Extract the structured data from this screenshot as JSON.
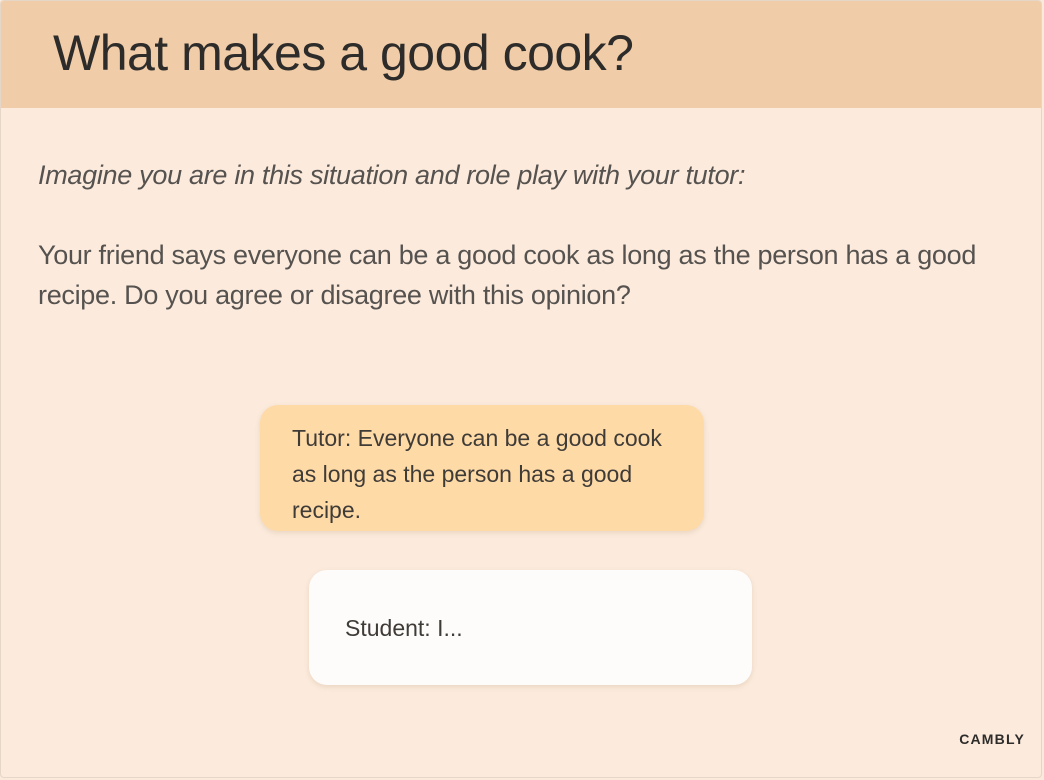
{
  "header": {
    "title": "What makes a good cook?"
  },
  "content": {
    "instruction": "Imagine you are in this situation and role play with your tutor:",
    "scenario": "Your friend says everyone can be a good cook as long as the person has a good recipe. Do you agree or disagree with this opinion?"
  },
  "dialogue": {
    "tutor_line": "Tutor: Everyone can be a good cook as long as the person has a good recipe.",
    "student_line": "Student: I..."
  },
  "footer": {
    "brand": "CAMBLY"
  },
  "colors": {
    "header_bg": "#f0cda8",
    "slide_bg": "#fcebdd",
    "tutor_bubble": "#fedaa7",
    "student_bubble": "#fdfcfb",
    "text": "#55524f"
  }
}
